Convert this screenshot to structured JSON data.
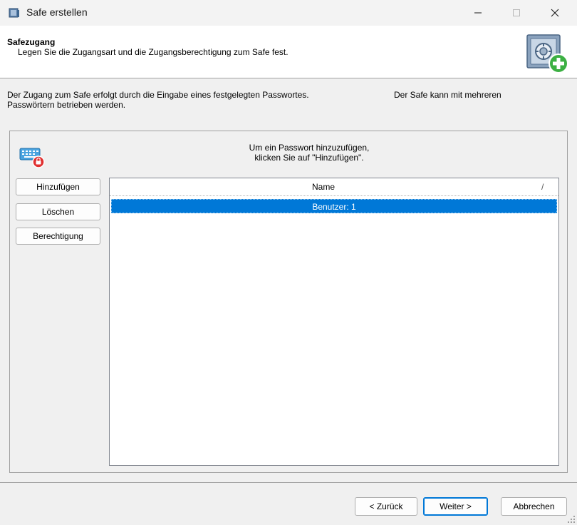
{
  "window": {
    "title": "Safe erstellen",
    "icon": "safe-app-icon",
    "controls": [
      "minimize-icon",
      "maximize-icon",
      "close-icon"
    ]
  },
  "header": {
    "title": "Safezugang",
    "subtitle": "Legen Sie die Zugangsart und die Zugangsberechtigung zum Safe fest.",
    "icon": "safe-add-icon"
  },
  "description": {
    "line1": "Der Zugang zum Safe erfolgt durch die Eingabe eines festgelegten Passwortes.",
    "line1_right": "Der Safe kann mit mehreren",
    "line2": "Passwörtern betrieben werden."
  },
  "group": {
    "icon": "keyboard-password-icon",
    "hint_line1": "Um ein Passwort hinzuzufügen,",
    "hint_line2": "klicken Sie auf \"Hinzufügen\".",
    "buttons": {
      "add": "Hinzufügen",
      "delete": "Löschen",
      "permission": "Berechtigung"
    },
    "list": {
      "column_header": "Name",
      "sort_indicator": "/",
      "rows": [
        "Benutzer: 1"
      ],
      "selected_index": 0
    }
  },
  "footer": {
    "back": "< Zurück",
    "next": "Weiter >",
    "cancel": "Abbrechen"
  },
  "colors": {
    "selection": "#0078d7",
    "accent_green": "#3cb043",
    "window_bg": "#f0f0f0"
  }
}
